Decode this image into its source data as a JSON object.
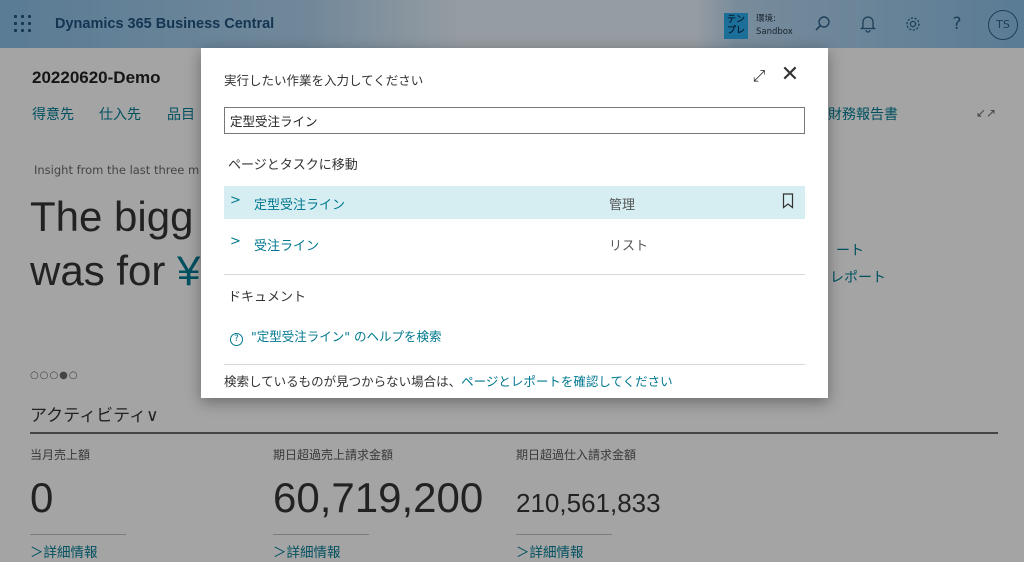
{
  "topbar": {
    "brand": "Dynamics 365 Business Central",
    "env_badge": "テン\nプレ",
    "env_label": "環境:",
    "env_name": "Sandbox",
    "avatar": "TS",
    "icons": [
      "waffle-icon",
      "search-icon",
      "bell-icon",
      "gear-icon",
      "help-icon"
    ]
  },
  "page": {
    "company": "20220620-Demo",
    "nav": [
      "得意先",
      "仕入先",
      "品目"
    ],
    "nav_right": "財務報告書",
    "insight": "Insight from the last three m",
    "headline1": "The bigg",
    "headline2": "was for ",
    "headline2_accent": "¥",
    "right_link1": "ート",
    "right_link2": "レポート",
    "dots": "○○○●○",
    "activity": "アクティビティ∨",
    "kpis": [
      {
        "label": "当月売上額",
        "value": "0",
        "link": "＞詳細情報"
      },
      {
        "label": "期日超過売上請求金額",
        "value": "60,719,200",
        "link": "＞詳細情報"
      },
      {
        "label": "期日超過仕入請求金額",
        "value": "210,561,833",
        "link": "＞詳細情報"
      }
    ]
  },
  "dialog": {
    "title": "実行したい作業を入力してください",
    "search_value": "定型受注ライン",
    "section_pages": "ページとタスクに移動",
    "results": [
      {
        "name": "定型受注ライン",
        "type": "管理",
        "selected": true
      },
      {
        "name": "受注ライン",
        "type": "リスト",
        "selected": false
      }
    ],
    "section_docs": "ドキュメント",
    "help_text": "\"定型受注ライン\" のヘルプを検索",
    "footer_text": "検索しているものが見つからない場合は、",
    "footer_link": "ページとレポートを確認してください"
  },
  "colors": {
    "accent": "#00788f",
    "selected_row": "#d6edf2",
    "brand": "#1e4f7a"
  }
}
